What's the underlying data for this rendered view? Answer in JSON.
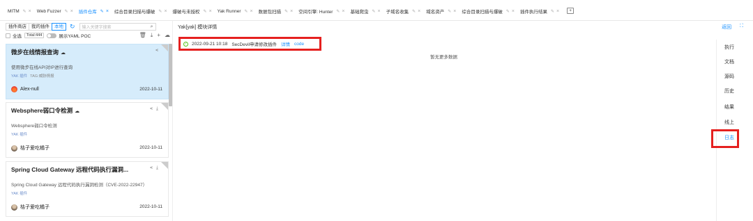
{
  "tabs": [
    {
      "label": "MITM",
      "active": false
    },
    {
      "label": "Web Fuzzer",
      "active": false
    },
    {
      "label": "插件仓库",
      "active": true
    },
    {
      "label": "综合目录扫描与爆破",
      "active": false
    },
    {
      "label": "爆破与未授权",
      "active": false
    },
    {
      "label": "Yak Runner",
      "active": false
    },
    {
      "label": "数据包扫描",
      "active": false
    },
    {
      "label": "空间引擎: Hunter",
      "active": false
    },
    {
      "label": "基础爬虫",
      "active": false
    },
    {
      "label": "子域名收集",
      "active": false
    },
    {
      "label": "域名资产",
      "active": false
    },
    {
      "label": "综合目录扫描与爆破",
      "active": false
    },
    {
      "label": "插件执行结果",
      "active": false
    }
  ],
  "header_right": {
    "back": "返回",
    "expand_icon": "expand-icon"
  },
  "left": {
    "filters": {
      "store": "插件商店",
      "mine": "我的插件",
      "local": "本地"
    },
    "search_placeholder": "输入关键字搜索",
    "select_all": "全选",
    "total": "Total:444",
    "show_yaml": "展示YAML POC",
    "cards": [
      {
        "title": "微步在线情报查询",
        "desc": "使用微步在线API对IP进行查询",
        "tag": "YAK 插件",
        "tag2": "TAG:威胁情报",
        "author": "Alex-null",
        "date": "2022-10-11",
        "selected": true
      },
      {
        "title": "Websphere弱口令检测",
        "desc": "Websphere弱口令检测",
        "tag": "YAK 插件",
        "tag2": "",
        "author": "桔子爱吃橘子",
        "date": "2022-10-11",
        "selected": false
      },
      {
        "title": "Spring Cloud Gateway 远程代码执行漏洞...",
        "desc": "Spring Cloud Gateway 远程代码执行漏洞检测（CVE-2022-22947）",
        "tag": "YAK 插件",
        "tag2": "",
        "author": "桔子爱吃橘子",
        "date": "2022-10-11",
        "selected": false
      }
    ]
  },
  "main": {
    "title": "Yak[yak] 模块详情",
    "log": {
      "time": "2022-09-21 10:18",
      "text": "SecDevil申请修改插件",
      "detail": "详情",
      "code": "code"
    },
    "empty": "暂无更多数据"
  },
  "sidemenu": [
    "执行",
    "文档",
    "源码",
    "历史",
    "结果",
    "线上",
    "日志"
  ],
  "sidemenu_active": "日志",
  "colors": {
    "accent": "#1890ff",
    "highlight_box": "#e5201f",
    "selected_card": "#d6ecfb"
  }
}
